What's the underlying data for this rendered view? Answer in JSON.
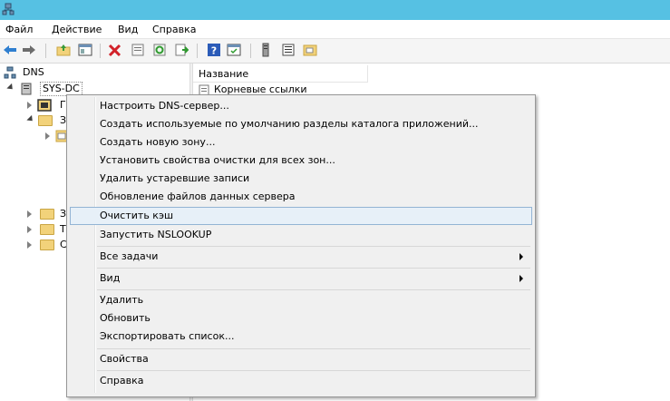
{
  "menubar": {
    "items": [
      "Файл",
      "Действие",
      "Вид",
      "Справка"
    ]
  },
  "toolbar": {
    "icons": [
      "back-icon",
      "forward-icon",
      "up-folder-icon",
      "show-tree-icon",
      "delete-icon",
      "properties-icon",
      "refresh-icon",
      "export-icon",
      "help-icon",
      "console-icon",
      "server-icon",
      "list-icon",
      "folder-icon"
    ]
  },
  "tree": {
    "root": "DNS",
    "server": "SYS-DC",
    "nodes": [
      "Г",
      "З",
      "",
      "З",
      "Т",
      "С"
    ]
  },
  "list": {
    "column": "Название",
    "rows": [
      "Корневые ссылки"
    ]
  },
  "context_menu": {
    "items": [
      "Настроить DNS-сервер...",
      "Создать используемые по умолчанию разделы каталога приложений...",
      "Создать новую зону...",
      "Установить свойства очистки для всех зон...",
      "Удалить устаревшие записи",
      "Обновление файлов данных сервера",
      "Очистить кэш",
      "Запустить NSLOOKUP",
      "Все задачи",
      "Вид",
      "Удалить",
      "Обновить",
      "Экспортировать список...",
      "Свойства",
      "Справка"
    ],
    "highlighted": "Очистить кэш"
  },
  "colors": {
    "titlebar": "#56c1e3",
    "highlight_bg": "#e7f0f8",
    "highlight_border": "#93b4d4",
    "menu_bg": "#f0f0f0"
  }
}
